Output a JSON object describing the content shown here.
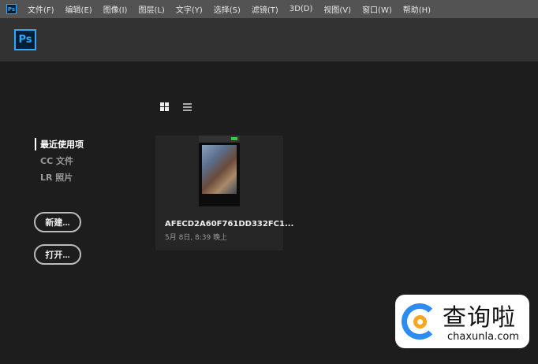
{
  "menubar": {
    "app_icon": "Ps",
    "items": [
      "文件(F)",
      "编辑(E)",
      "图像(I)",
      "图层(L)",
      "文字(Y)",
      "选择(S)",
      "滤镜(T)",
      "3D(D)",
      "视图(V)",
      "窗口(W)",
      "帮助(H)"
    ]
  },
  "header": {
    "logo": "Ps"
  },
  "view_toggle": {
    "grid_icon": "grid-view-icon",
    "list_icon": "list-view-icon",
    "selected": "grid"
  },
  "sidebar": {
    "items": [
      {
        "label": "最近使用项",
        "active": true
      },
      {
        "label": "CC 文件"
      },
      {
        "label": "LR 照片"
      }
    ]
  },
  "buttons": {
    "new": "新建...",
    "open": "打开..."
  },
  "recent_files": [
    {
      "name": "AFECD2A60F761DD332FC1...",
      "date": "5月 8日, 8:39 晚上"
    }
  ],
  "watermark": {
    "cn": "查询啦",
    "en": "chaxunla.com"
  },
  "colors": {
    "accent": "#31a8ff",
    "menubar": "#535353",
    "header": "#323232",
    "background": "#1d1d1d"
  }
}
